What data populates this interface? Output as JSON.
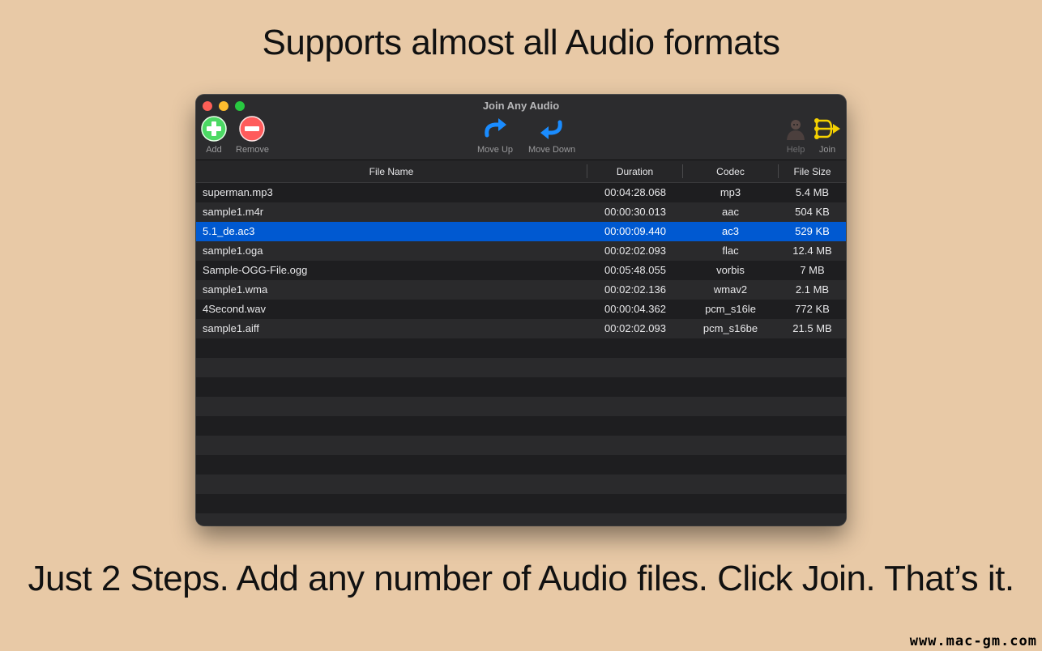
{
  "headline_top": "Supports almost all Audio formats",
  "headline_bottom": "Just 2 Steps. Add any number of Audio files. Click Join. That’s it.",
  "watermark": "www.mac-gm.com",
  "window": {
    "title": "Join Any Audio"
  },
  "toolbar": {
    "add_label": "Add",
    "remove_label": "Remove",
    "move_up_label": "Move Up",
    "move_down_label": "Move Down",
    "help_label": "Help",
    "join_label": "Join"
  },
  "colors": {
    "add": "#4cd964",
    "remove": "#ff5b5b",
    "move": "#1a8cff",
    "join": "#f5d100",
    "selected_row": "#0059d1"
  },
  "table": {
    "columns": [
      "File Name",
      "Duration",
      "Codec",
      "File Size"
    ],
    "rows": [
      {
        "name": "superman.mp3",
        "duration": "00:04:28.068",
        "codec": "mp3",
        "size": "5.4 MB"
      },
      {
        "name": "sample1.m4r",
        "duration": "00:00:30.013",
        "codec": "aac",
        "size": "504 KB"
      },
      {
        "name": "5.1_de.ac3",
        "duration": "00:00:09.440",
        "codec": "ac3",
        "size": "529 KB",
        "selected": true
      },
      {
        "name": "sample1.oga",
        "duration": "00:02:02.093",
        "codec": "flac",
        "size": "12.4 MB"
      },
      {
        "name": "Sample-OGG-File.ogg",
        "duration": "00:05:48.055",
        "codec": "vorbis",
        "size": "7 MB"
      },
      {
        "name": "sample1.wma",
        "duration": "00:02:02.136",
        "codec": "wmav2",
        "size": "2.1 MB"
      },
      {
        "name": "4Second.wav",
        "duration": "00:00:04.362",
        "codec": "pcm_s16le",
        "size": "772 KB"
      },
      {
        "name": "sample1.aiff",
        "duration": "00:02:02.093",
        "codec": "pcm_s16be",
        "size": "21.5 MB"
      }
    ]
  }
}
